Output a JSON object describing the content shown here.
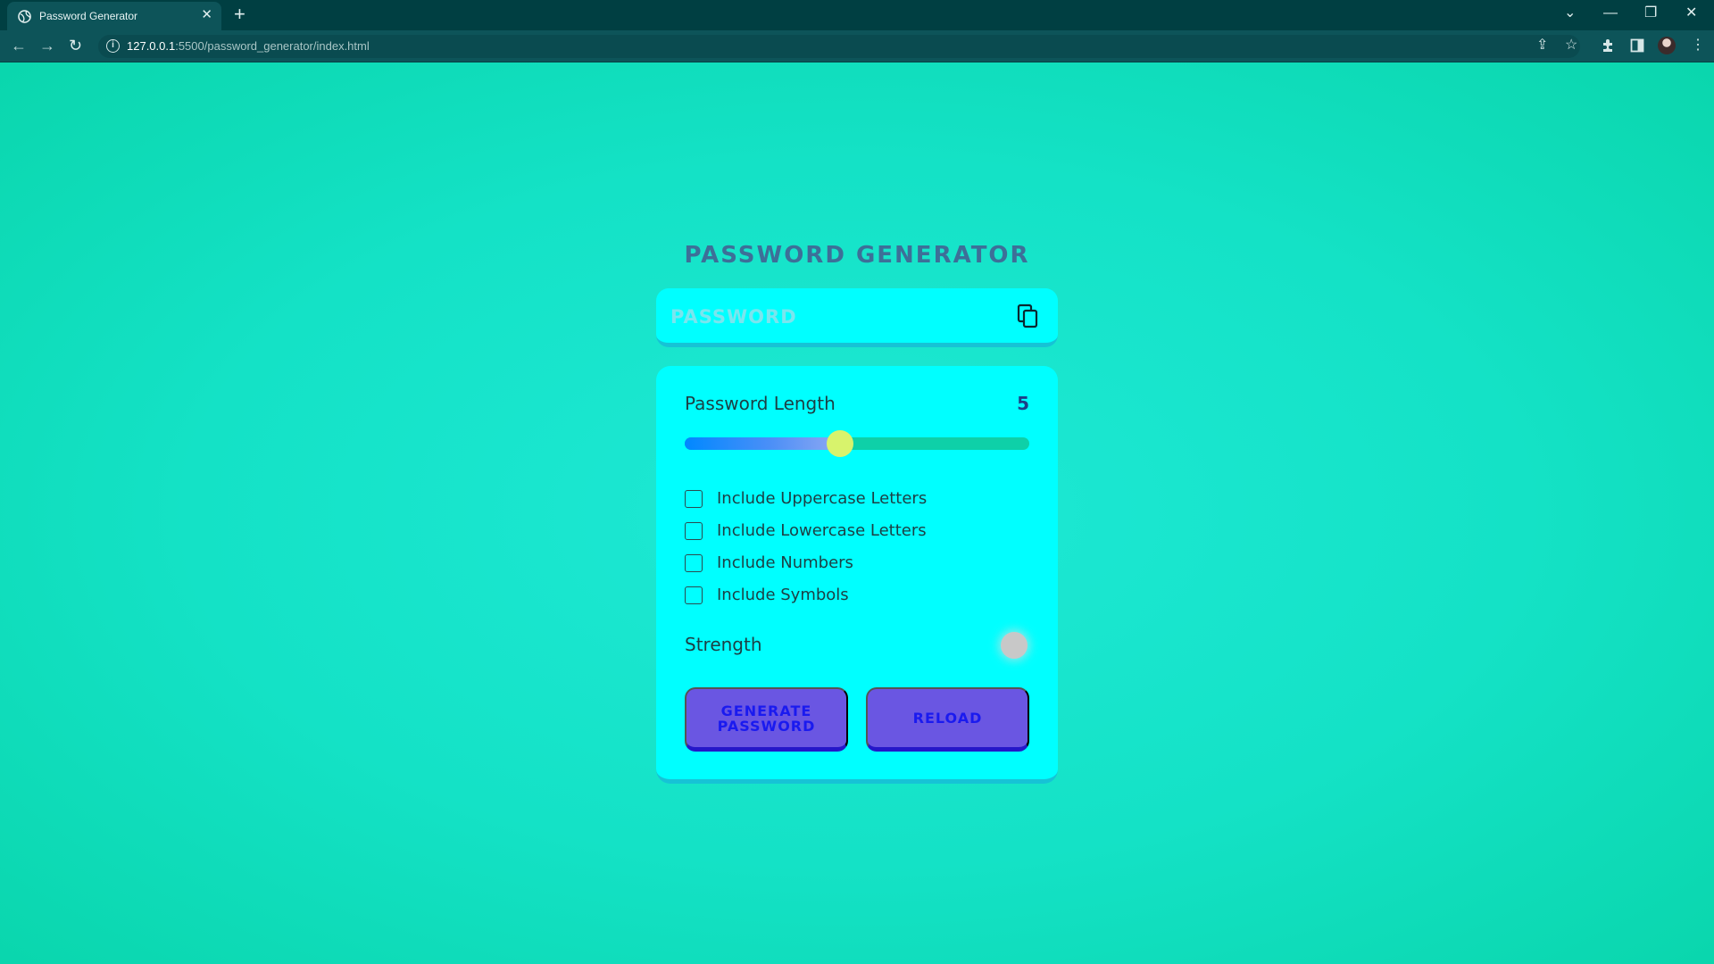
{
  "browser": {
    "tab_title": "Password Generator",
    "tab_close": "✕",
    "new_tab": "+",
    "url_host": "127.0.0.1",
    "url_rest": ":5500/password_generator/index.html",
    "controls": {
      "dropdown": "⌄",
      "minimize": "—",
      "restore": "❐",
      "close": "✕"
    }
  },
  "app": {
    "title": "PASSWORD GENERATOR",
    "password_placeholder": "PASSWORD",
    "length_label": "Password Length",
    "length_value": "5",
    "slider_fraction": 0.45,
    "options": [
      {
        "label": "Include Uppercase Letters",
        "checked": false
      },
      {
        "label": "Include Lowercase Letters",
        "checked": false
      },
      {
        "label": "Include Numbers",
        "checked": false
      },
      {
        "label": "Include Symbols",
        "checked": false
      }
    ],
    "strength_label": "Strength",
    "strength_color": "#c8c8c8",
    "generate_label": "GENERATE PASSWORD",
    "reload_label": "RELOAD"
  },
  "colors": {
    "page_bg": "#14e2c6",
    "card_bg": "#00ffff",
    "title": "#3d6f98",
    "button_bg": "#6a56e2",
    "button_text": "#1a1aef",
    "slider_thumb": "#d8f36c"
  }
}
